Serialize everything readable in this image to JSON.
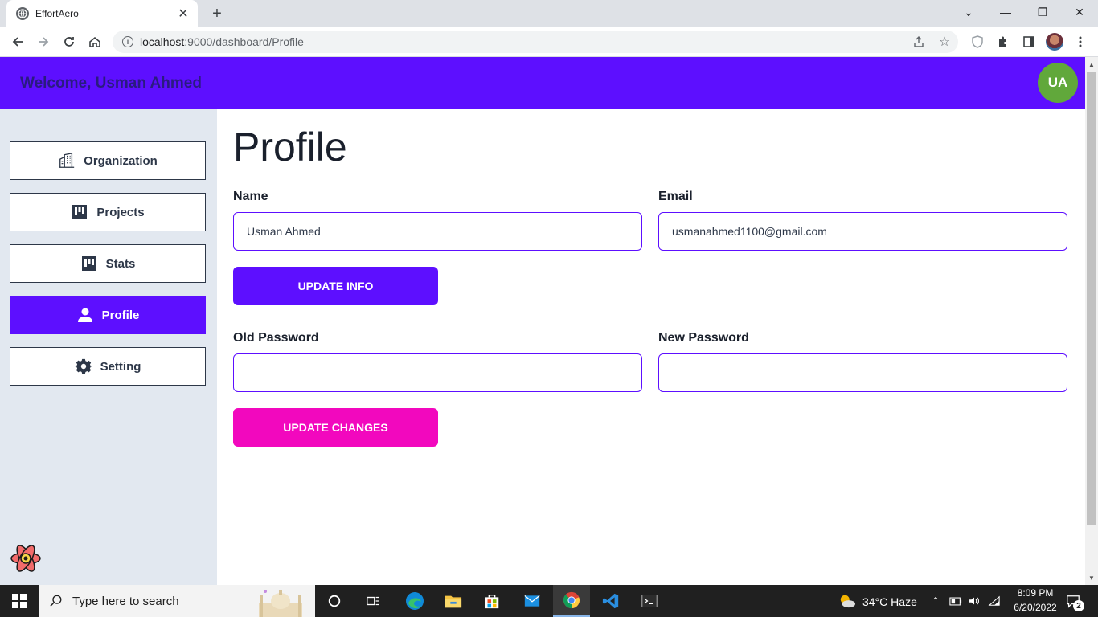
{
  "browser": {
    "tab_title": "EffortAero",
    "url_host": "localhost",
    "url_path": ":9000/dashboard/Profile"
  },
  "header": {
    "welcome": "Welcome, Usman Ahmed",
    "avatar_initials": "UA"
  },
  "sidebar": {
    "items": [
      {
        "label": "Organization",
        "icon": "building-icon"
      },
      {
        "label": "Projects",
        "icon": "board-icon"
      },
      {
        "label": "Stats",
        "icon": "board-icon"
      },
      {
        "label": "Profile",
        "icon": "user-icon",
        "active": true
      },
      {
        "label": "Setting",
        "icon": "gear-icon"
      }
    ]
  },
  "profile": {
    "title": "Profile",
    "name_label": "Name",
    "name_value": "Usman Ahmed",
    "email_label": "Email",
    "email_value": "usmanahmed1100@gmail.com",
    "update_info_label": "UPDATE INFO",
    "old_password_label": "Old Password",
    "new_password_label": "New Password",
    "update_changes_label": "UPDATE CHANGES"
  },
  "taskbar": {
    "search_placeholder": "Type here to search",
    "weather": "34°C  Haze",
    "time": "8:09 PM",
    "date": "6/20/2022",
    "notification_count": "2"
  },
  "colors": {
    "primary": "#5d0fff",
    "accent_pink": "#f208be",
    "avatar_green": "#61a83b",
    "sidebar_bg": "#e2e8f0"
  }
}
